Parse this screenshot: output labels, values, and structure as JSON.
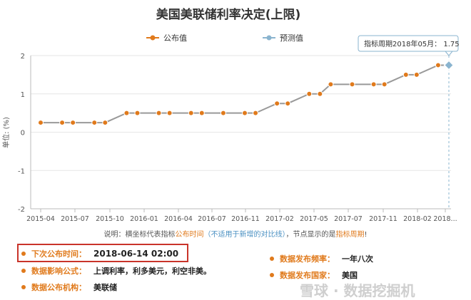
{
  "chart_data": {
    "type": "line",
    "title": "美国美联储利率决定(上限)",
    "ylabel": "单位: (%)",
    "ylim": [
      -2,
      2
    ],
    "yticks": [
      2,
      1,
      0,
      -1,
      -2
    ],
    "xticks": [
      "2015-04",
      "2015-07",
      "2015-10",
      "2016-01",
      "2016-04",
      "2016-07",
      "2016-11",
      "2017-02",
      "2017-05",
      "2017-07",
      "2017-11",
      "2018-02",
      "2018..."
    ],
    "x": [
      "2015-04",
      "2015-06",
      "2015-07",
      "2015-09",
      "2015-10",
      "2015-12",
      "2016-01",
      "2016-03",
      "2016-04",
      "2016-06",
      "2016-07",
      "2016-09",
      "2016-11",
      "2016-12",
      "2017-02",
      "2017-03",
      "2017-05",
      "2017-06",
      "2017-07",
      "2017-09",
      "2017-11",
      "2017-12",
      "2018-02",
      "2018-03",
      "2018-05",
      "2018-06"
    ],
    "series": [
      {
        "name": "公布值",
        "color": "#e07a1c",
        "values": [
          0.25,
          0.25,
          0.25,
          0.25,
          0.25,
          0.5,
          0.5,
          0.5,
          0.5,
          0.5,
          0.5,
          0.5,
          0.5,
          0.5,
          0.75,
          0.75,
          1.0,
          1.0,
          1.25,
          1.25,
          1.25,
          1.25,
          1.5,
          1.5,
          1.75,
          null
        ]
      },
      {
        "name": "预测值",
        "color": "#8ab4cf",
        "values": [
          null,
          null,
          null,
          null,
          null,
          null,
          null,
          null,
          null,
          null,
          null,
          null,
          null,
          null,
          null,
          null,
          null,
          null,
          null,
          null,
          null,
          null,
          null,
          null,
          null,
          1.75
        ]
      }
    ],
    "line_color": "#999999",
    "tooltip": {
      "label": "指标周期2018年05月：",
      "value": "1.75"
    }
  },
  "note": {
    "prefix": "说明：横坐标代表指标",
    "highlight1": "公布时间",
    "hint": "（不适用于新增的对比线）",
    "middle": "，节点显示的是",
    "highlight2": "指标周期",
    "suffix": "!"
  },
  "info": {
    "next_release_label": "下次公布时间：",
    "next_release_value": "2018-06-14 02:00",
    "impact_label": "数据影响公式：",
    "impact_value": "上调利率，利多美元，利空非美。",
    "agency_label": "数据公布机构：",
    "agency_value": "美联储",
    "frequency_label": "数据发布频率：",
    "frequency_value": "一年八次",
    "country_label": "数据发布国家：",
    "country_value": "美国"
  },
  "watermark": "雪球 · 数据挖掘机"
}
